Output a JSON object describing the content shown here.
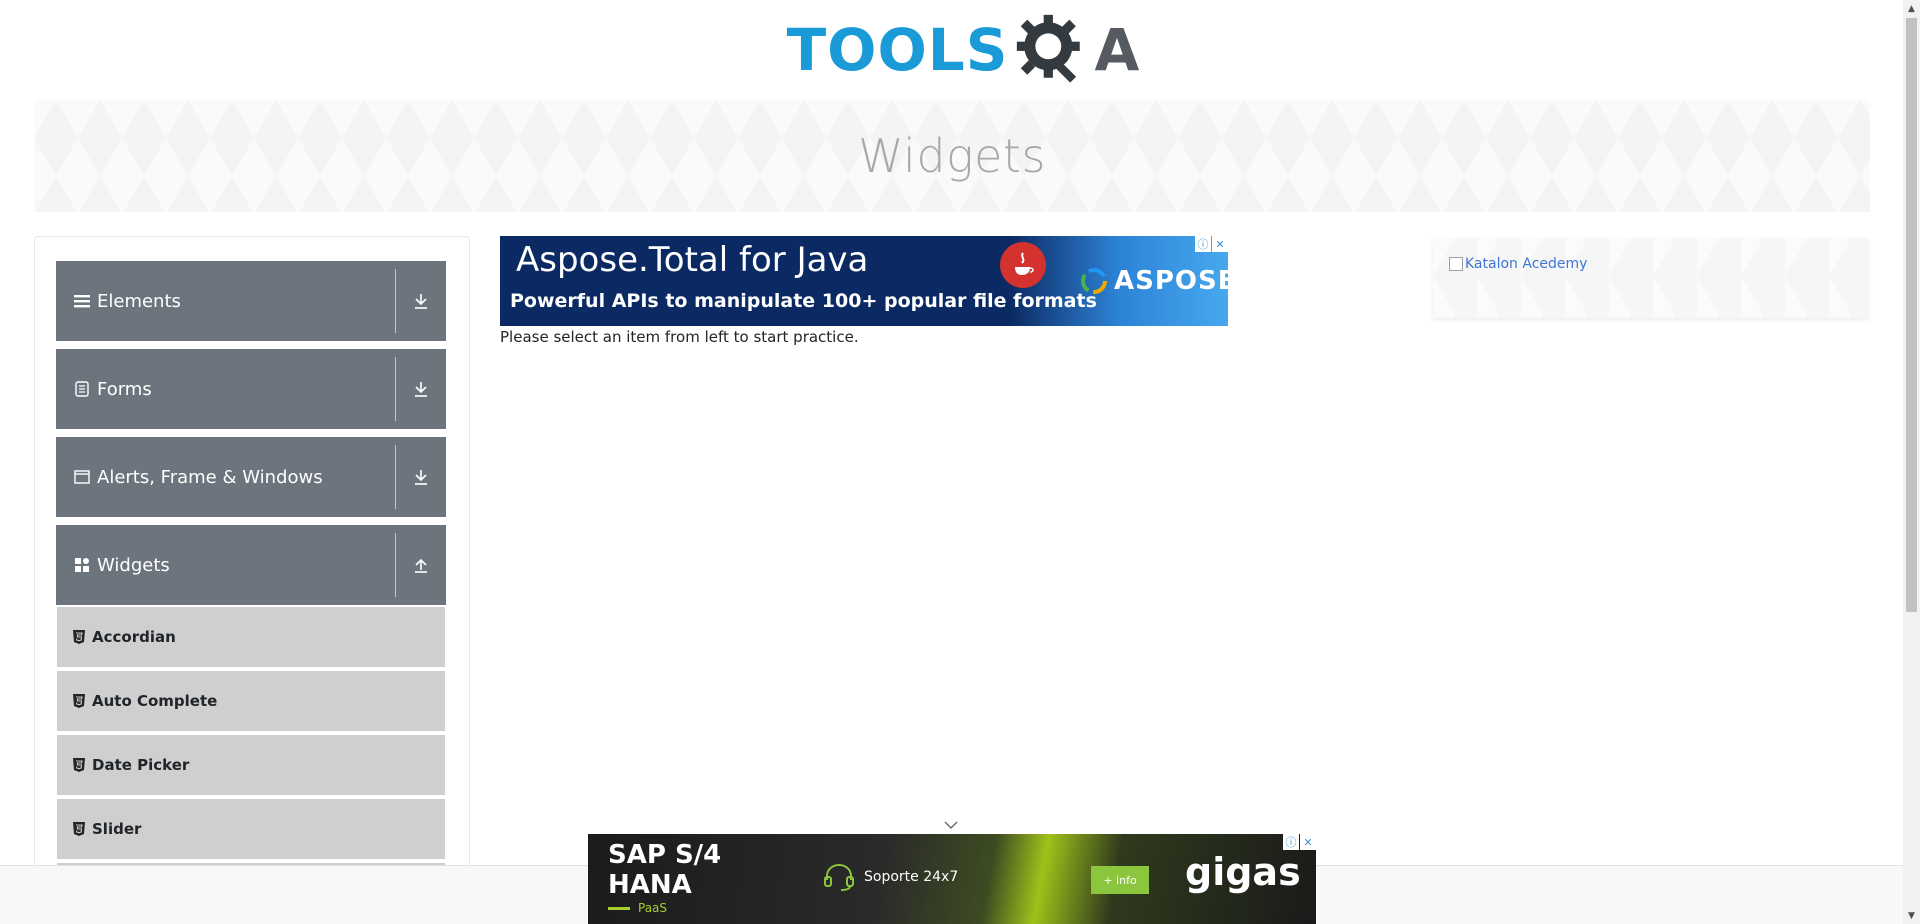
{
  "header": {
    "logo_text_tools": "TOOLS",
    "logo_text_a": "A",
    "logo_colors": {
      "tools": "#1b9ad8",
      "gear": "#333a40",
      "a": "#555b61"
    }
  },
  "banner": {
    "title": "Widgets"
  },
  "sidebar": {
    "groups": [
      {
        "label": "Elements",
        "icon": "hamburger-icon",
        "toggle_icon": "download-arrow-icon",
        "expanded": false
      },
      {
        "label": "Forms",
        "icon": "form-icon",
        "toggle_icon": "download-arrow-icon",
        "expanded": false
      },
      {
        "label": "Alerts, Frame & Windows",
        "icon": "window-icon",
        "toggle_icon": "download-arrow-icon",
        "expanded": false
      },
      {
        "label": "Widgets",
        "icon": "widgets-grid-icon",
        "toggle_icon": "upload-arrow-icon",
        "expanded": true
      }
    ],
    "widget_items": [
      {
        "label": "Accordian",
        "icon": "html5-icon"
      },
      {
        "label": "Auto Complete",
        "icon": "html5-icon"
      },
      {
        "label": "Date Picker",
        "icon": "html5-icon"
      },
      {
        "label": "Slider",
        "icon": "html5-icon"
      }
    ]
  },
  "main": {
    "ad_top": {
      "title": "Aspose.Total for Java",
      "subtitle": "Powerful APIs to manipulate 100+ popular file formats",
      "brand": "ASPOSE"
    },
    "instruction": "Please select an item from left to start practice."
  },
  "right_ad": {
    "alt_text": "Katalon Acedemy"
  },
  "bottom_ad": {
    "title_line1": "SAP S/4",
    "title_line2": "HANA",
    "paas": "PaaS",
    "support": "Soporte 24x7",
    "info_button": "+ info",
    "brand": "gigas"
  },
  "colors": {
    "sidebar_group_bg": "#6c757d",
    "sidebar_item_bg": "#cfcfcf",
    "link_blue": "#3f74d6"
  }
}
